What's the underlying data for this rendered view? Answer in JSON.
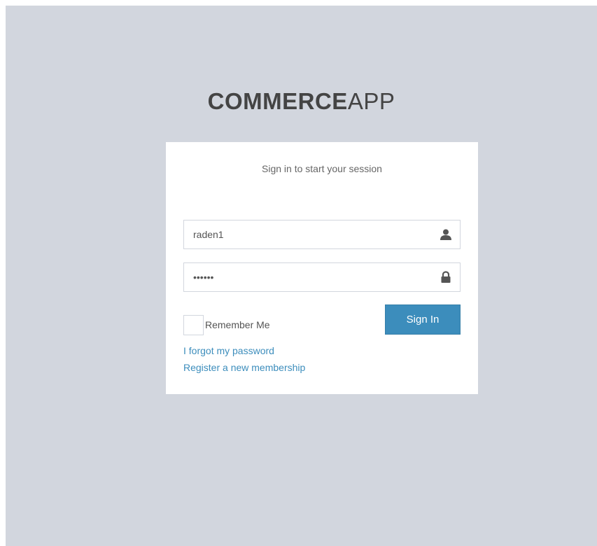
{
  "logo": {
    "bold": "COMMERCE",
    "light": "APP"
  },
  "login": {
    "message": "Sign in to start your session",
    "username": {
      "value": "raden1",
      "icon": "user-icon"
    },
    "password": {
      "value": "raden1",
      "icon": "lock-icon"
    },
    "remember_label": "Remember Me",
    "remember_checked": false,
    "submit_label": "Sign In",
    "forgot_link": "I forgot my password",
    "register_link": "Register a new membership"
  },
  "colors": {
    "page_background": "#d2d6de",
    "primary": "#3c8dbc",
    "logo_text": "#444444"
  }
}
